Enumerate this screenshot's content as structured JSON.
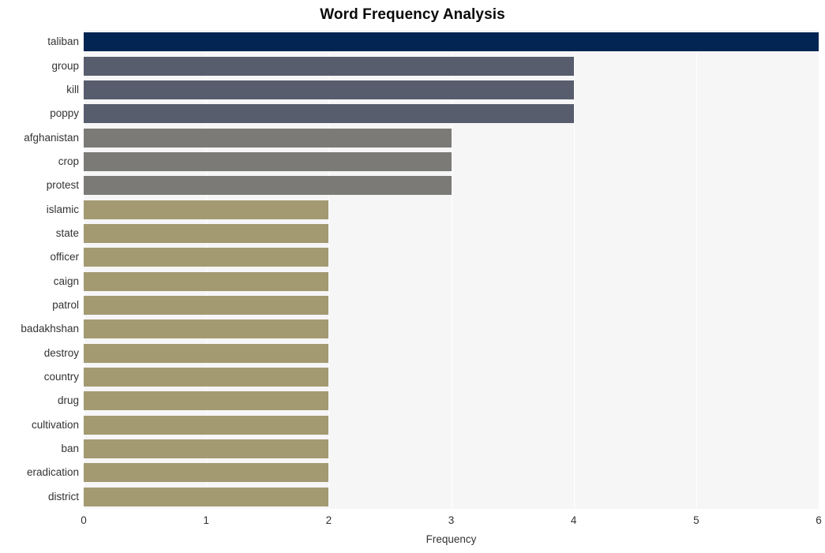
{
  "chart_data": {
    "type": "bar",
    "orientation": "horizontal",
    "title": "Word Frequency Analysis",
    "xlabel": "Frequency",
    "ylabel": "",
    "xlim": [
      0,
      6
    ],
    "xticks": [
      "0",
      "1",
      "2",
      "3",
      "4",
      "5",
      "6"
    ],
    "grid": true,
    "legend": false,
    "categories": [
      "taliban",
      "group",
      "kill",
      "poppy",
      "afghanistan",
      "crop",
      "protest",
      "islamic",
      "state",
      "officer",
      "caign",
      "patrol",
      "badakhshan",
      "destroy",
      "country",
      "drug",
      "cultivation",
      "ban",
      "eradication",
      "district"
    ],
    "values": [
      6,
      4,
      4,
      4,
      3,
      3,
      3,
      2,
      2,
      2,
      2,
      2,
      2,
      2,
      2,
      2,
      2,
      2,
      2,
      2
    ],
    "bar_colors": [
      "#032554",
      "#585d6e",
      "#585d6e",
      "#585d6e",
      "#7b7a77",
      "#7b7a77",
      "#7b7a77",
      "#a39a72",
      "#a39a72",
      "#a39a72",
      "#a39a72",
      "#a39a72",
      "#a39a72",
      "#a39a72",
      "#a39a72",
      "#a39a72",
      "#a39a72",
      "#a39a72",
      "#a39a72",
      "#a39a72"
    ]
  },
  "style": {
    "plot_background": "#f6f6f7",
    "gridline_color": "#ffffff",
    "page_background": "#ffffff",
    "tick_text_color": "#333333",
    "title_color": "#0a0a0a"
  }
}
